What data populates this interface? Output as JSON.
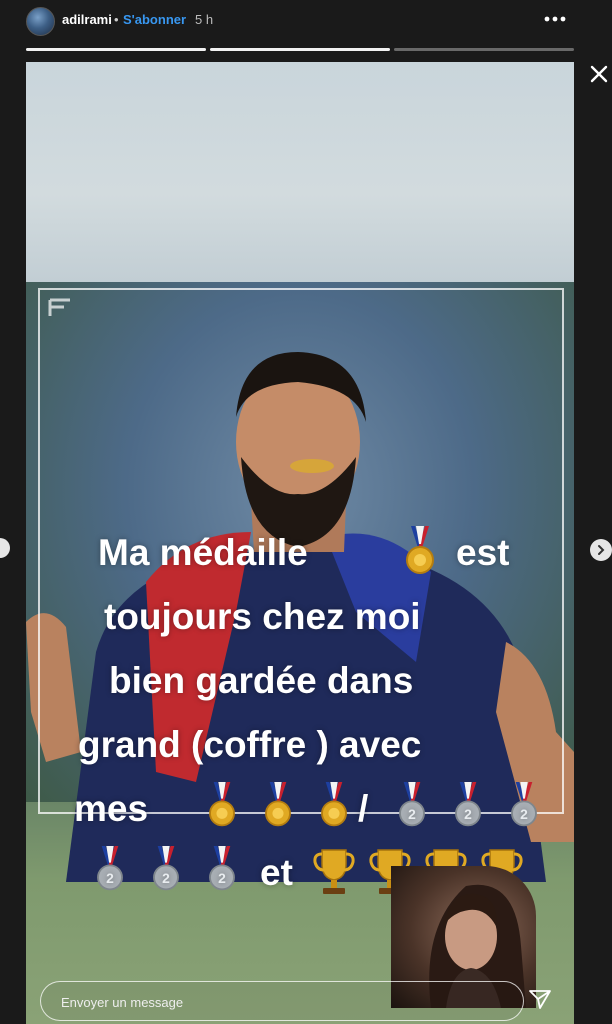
{
  "header": {
    "username": "adilrami",
    "separator": "•",
    "follow_label": "S'abonner",
    "time_ago": "5 h",
    "progress": {
      "segments": 3,
      "current": 2
    }
  },
  "story": {
    "text_lines": [
      "Ma médaille",
      "est",
      "toujours chez moi",
      "bien gardée dans",
      "grand (coffre ) avec",
      "mes",
      "/",
      "et"
    ],
    "emoji": {
      "gold_medals": 3,
      "silver_medals_line1": 3,
      "silver_medals_line2": 3,
      "trophies": 4
    }
  },
  "composer": {
    "placeholder": "Envoyer un message"
  },
  "icons": {
    "more": "more-icon",
    "close": "close-icon",
    "send": "send-icon",
    "next": "chevron-right-icon",
    "prev": "chevron-left-icon"
  },
  "colors": {
    "follow_blue": "#3897f0",
    "background": "#1a1a1a"
  }
}
